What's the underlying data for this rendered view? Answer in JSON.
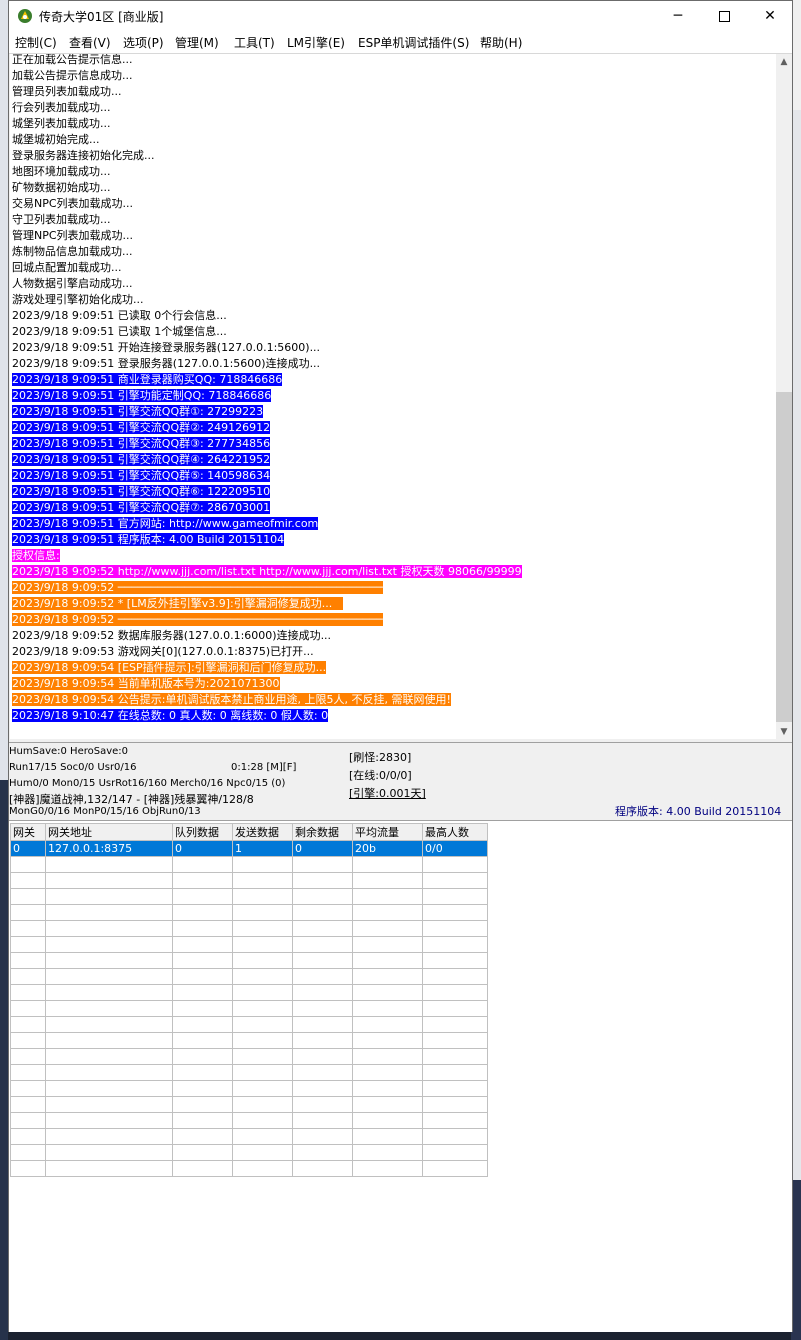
{
  "window": {
    "title": "传奇大学01区 [商业版]"
  },
  "menu": [
    "控制(C)",
    "查看(V)",
    "选项(P)",
    "管理(M)",
    "工具(T)",
    "LM引擎(E)",
    "ESP单机调试插件(S)",
    "帮助(H)"
  ],
  "log": [
    {
      "text": "正在加载公告提示信息...",
      "style": ""
    },
    {
      "text": "加载公告提示信息成功...",
      "style": ""
    },
    {
      "text": "管理员列表加载成功...",
      "style": ""
    },
    {
      "text": "行会列表加载成功...",
      "style": ""
    },
    {
      "text": "城堡列表加载成功...",
      "style": ""
    },
    {
      "text": "城堡城初始完成...",
      "style": ""
    },
    {
      "text": "登录服务器连接初始化完成...",
      "style": ""
    },
    {
      "text": "地图环境加载成功...",
      "style": ""
    },
    {
      "text": "矿物数据初始成功...",
      "style": ""
    },
    {
      "text": "交易NPC列表加载成功...",
      "style": ""
    },
    {
      "text": "守卫列表加载成功...",
      "style": ""
    },
    {
      "text": "管理NPC列表加载成功...",
      "style": ""
    },
    {
      "text": "炼制物品信息加载成功...",
      "style": ""
    },
    {
      "text": "回城点配置加载成功...",
      "style": ""
    },
    {
      "text": "人物数据引擎启动成功...",
      "style": ""
    },
    {
      "text": "游戏处理引擎初始化成功...",
      "style": ""
    },
    {
      "text": "2023/9/18 9:09:51 已读取 0个行会信息...",
      "style": ""
    },
    {
      "text": "2023/9/18 9:09:51 已读取 1个城堡信息...",
      "style": ""
    },
    {
      "text": "2023/9/18 9:09:51 开始连接登录服务器(127.0.0.1:5600)...",
      "style": ""
    },
    {
      "text": "2023/9/18 9:09:51 登录服务器(127.0.0.1:5600)连接成功...",
      "style": ""
    },
    {
      "text": "2023/9/18 9:09:51 商业登录器购买QQ: 718846686",
      "style": "blue"
    },
    {
      "text": "2023/9/18 9:09:51 引擎功能定制QQ: 718846686",
      "style": "blue"
    },
    {
      "text": "2023/9/18 9:09:51 引擎交流QQ群①: 27299223",
      "style": "blue"
    },
    {
      "text": "2023/9/18 9:09:51 引擎交流QQ群②: 249126912",
      "style": "blue"
    },
    {
      "text": "2023/9/18 9:09:51 引擎交流QQ群③: 277734856",
      "style": "blue"
    },
    {
      "text": "2023/9/18 9:09:51 引擎交流QQ群④: 264221952",
      "style": "blue"
    },
    {
      "text": "2023/9/18 9:09:51 引擎交流QQ群⑤: 140598634",
      "style": "blue"
    },
    {
      "text": "2023/9/18 9:09:51 引擎交流QQ群⑥: 122209510",
      "style": "blue"
    },
    {
      "text": "2023/9/18 9:09:51 引擎交流QQ群⑦: 286703001",
      "style": "blue"
    },
    {
      "text": "2023/9/18 9:09:51 官方网站: http://www.gameofmir.com",
      "style": "blue"
    },
    {
      "text": "2023/9/18 9:09:51 程序版本: 4.00 Build 20151104",
      "style": "blue"
    },
    {
      "text": "授权信息:",
      "style": "magenta"
    },
    {
      "text": "2023/9/18 9:09:52 http://www.jjj.com/list.txt http://www.jjj.com/list.txt 授权天数 98066/99999",
      "style": "magenta"
    },
    {
      "text": "2023/9/18 9:09:52 ────────────────────────────────────────",
      "style": "orange"
    },
    {
      "text": "2023/9/18 9:09:52 * [LM反外挂引擎v3.9]:引擎漏洞修复成功...   ",
      "style": "orange"
    },
    {
      "text": "2023/9/18 9:09:52 ────────────────────────────────────────",
      "style": "orange"
    },
    {
      "text": "2023/9/18 9:09:52 数据库服务器(127.0.0.1:6000)连接成功...",
      "style": ""
    },
    {
      "text": "2023/9/18 9:09:53 游戏网关[0](127.0.0.1:8375)已打开...",
      "style": ""
    },
    {
      "text": "2023/9/18 9:09:54 [ESP插件提示]:引擎漏洞和后门修复成功...",
      "style": "orange"
    },
    {
      "text": "2023/9/18 9:09:54 当前单机版本号为:2021071300",
      "style": "orange"
    },
    {
      "text": "2023/9/18 9:09:54 公告提示:单机调试版本禁止商业用途, 上限5人, 不反挂, 需联网使用!",
      "style": "orange"
    },
    {
      "text": "2023/9/18 9:10:47 在线总数: 0 真人数: 0 离线数: 0 假人数: 0",
      "style": "blue"
    }
  ],
  "status": {
    "line1": "HumSave:0 HeroSave:0",
    "line2a": "Run17/15 Soc0/0 Usr0/16",
    "line2b": "0:1:28 [M][F]",
    "line3": "Hum0/0 Mon0/15 UsrRot16/160 Merch0/16 Npc0/15 (0)",
    "line4": "[神器]魔道战神,132/147 - [神器]残暴翼神/128/8",
    "line5": "MonG0/0/16 MonP0/15/16 ObjRun0/13",
    "refresh": "[刷怪:2830]",
    "online": "[在线:0/0/0]",
    "engine": "[引擎:0.001天]",
    "version": "程序版本: 4.00 Build 20151104"
  },
  "gateway_table": {
    "headers": [
      "网关",
      "网关地址",
      "队列数据",
      "发送数据",
      "剩余数据",
      "平均流量",
      "最高人数"
    ],
    "rows": [
      [
        "0",
        "127.0.0.1:8375",
        "0",
        "1",
        "0",
        "20b",
        "0/0"
      ]
    ],
    "empty_rows": 20
  },
  "colors": {
    "highlight_blue": "#0000ff",
    "highlight_magenta": "#ff00ff",
    "highlight_orange": "#ff8000",
    "selection": "#0078d7"
  }
}
